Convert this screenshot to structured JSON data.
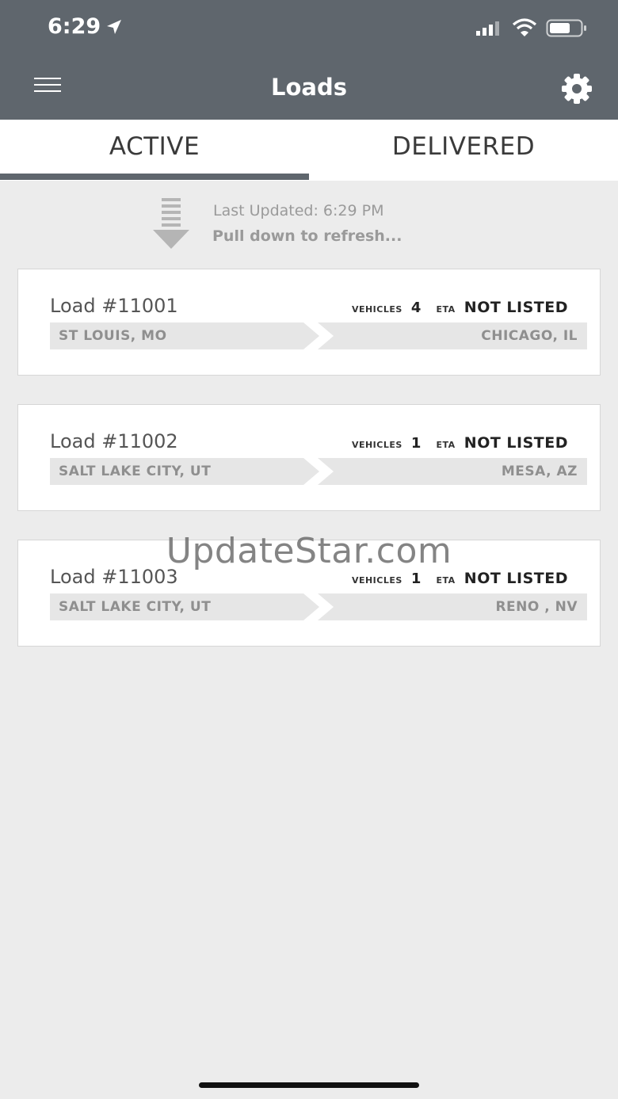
{
  "status_bar": {
    "time": "6:29"
  },
  "header": {
    "title": "Loads"
  },
  "tabs": [
    {
      "label": "ACTIVE",
      "selected": true
    },
    {
      "label": "DELIVERED",
      "selected": false
    }
  ],
  "refresh": {
    "last_updated": "Last Updated: 6:29 PM",
    "hint": "Pull down to refresh..."
  },
  "meta_labels": {
    "vehicles": "VEHICLES",
    "eta": "ETA"
  },
  "loads": [
    {
      "title": "Load #11001",
      "vehicles": "4",
      "eta": "NOT LISTED",
      "origin": "ST LOUIS, MO",
      "destination": "CHICAGO, IL"
    },
    {
      "title": "Load #11002",
      "vehicles": "1",
      "eta": "NOT LISTED",
      "origin": "SALT LAKE CITY, UT",
      "destination": "MESA, AZ"
    },
    {
      "title": "Load #11003",
      "vehicles": "1",
      "eta": "NOT LISTED",
      "origin": "SALT LAKE CITY, UT",
      "destination": "RENO , NV"
    }
  ],
  "watermark": "UpdateStar.com",
  "colors": {
    "header_bg": "#5f666d",
    "page_bg": "#ececec",
    "route_bg": "#e6e6e6"
  }
}
